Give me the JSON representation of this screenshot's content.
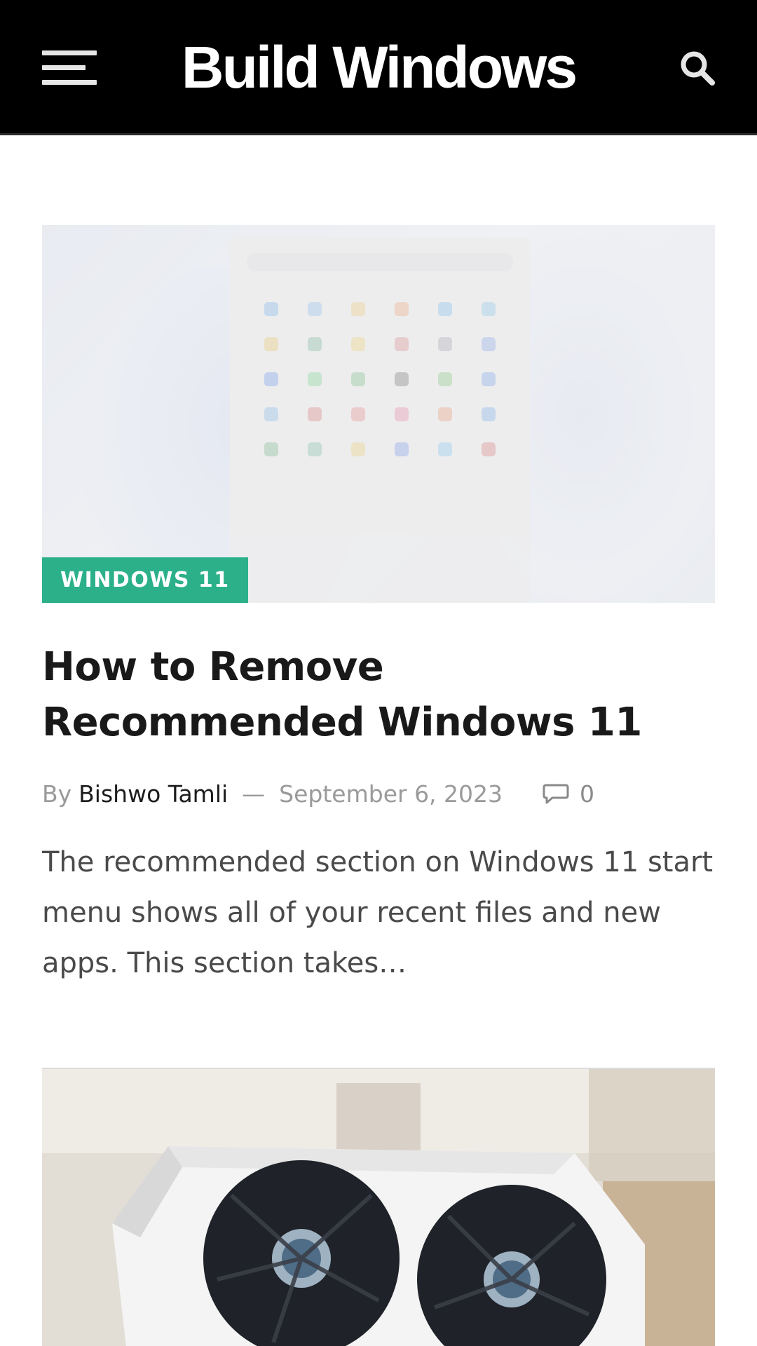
{
  "header": {
    "site_title": "Build Windows",
    "menu_icon": "hamburger-menu-icon",
    "search_icon": "search-icon",
    "background": "#000000"
  },
  "posts": [
    {
      "category": "WINDOWS 11",
      "category_color": "#2bb08a",
      "title": "How to Remove Recommended Windows 11",
      "by_label": "By",
      "author": "Bishwo Tamli",
      "separator": "—",
      "date": "September 6, 2023",
      "comment_icon": "comment-icon",
      "comments": "0",
      "excerpt": "The recommended section on Windows 11 start menu shows all of your recent files and new apps. This section takes…"
    },
    {
      "image_subject": "graphics-card-photo"
    }
  ]
}
